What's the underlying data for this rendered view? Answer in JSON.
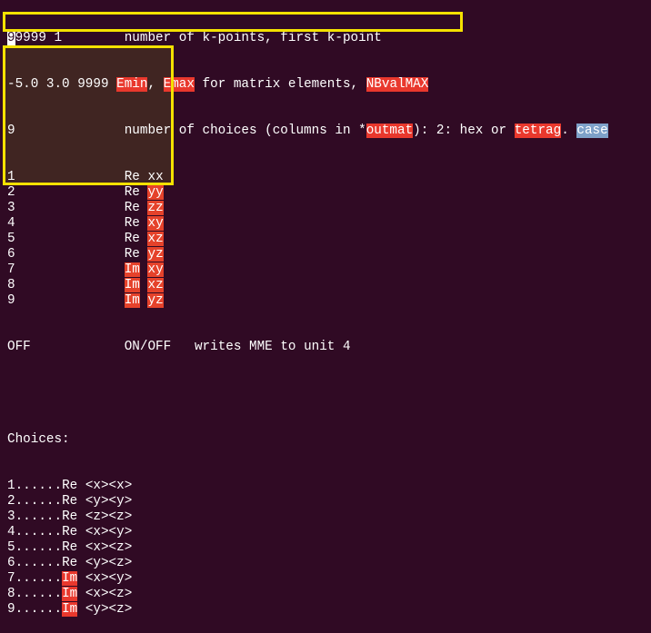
{
  "header_lines": {
    "l1_value_cursor": "9",
    "l1_value": "9999 1",
    "l1_desc": "number of k-points, first k-point",
    "l2_value": "-5.0 3.0 9999 ",
    "l2_emin": "Emin",
    "l2_sep1": ", ",
    "l2_emax": "Emax",
    "l2_mid": " for matrix elements, ",
    "l2_nbval": "NBvalMAX",
    "l3_value": "9",
    "l3_desc_a": "number of choices (columns in *",
    "l3_outmat": "outmat",
    "l3_desc_b": "): 2: hex or ",
    "l3_tetrag": "tetrag",
    "l3_dot": ". ",
    "l3_case": "case"
  },
  "choice_rows": [
    {
      "n": "1",
      "part": "Re",
      "comp": "xx",
      "part_hl": false,
      "comp_hl": false
    },
    {
      "n": "2",
      "part": "Re",
      "comp": "yy",
      "part_hl": false,
      "comp_hl": true
    },
    {
      "n": "3",
      "part": "Re",
      "comp": "zz",
      "part_hl": false,
      "comp_hl": true
    },
    {
      "n": "4",
      "part": "Re",
      "comp": "xy",
      "part_hl": false,
      "comp_hl": true
    },
    {
      "n": "5",
      "part": "Re",
      "comp": "xz",
      "part_hl": false,
      "comp_hl": true
    },
    {
      "n": "6",
      "part": "Re",
      "comp": "yz",
      "part_hl": false,
      "comp_hl": true
    },
    {
      "n": "7",
      "part": "Im",
      "comp": "xy",
      "part_hl": true,
      "comp_hl": true
    },
    {
      "n": "8",
      "part": "Im",
      "comp": "xz",
      "part_hl": true,
      "comp_hl": true
    },
    {
      "n": "9",
      "part": "Im",
      "comp": "yz",
      "part_hl": true,
      "comp_hl": true
    }
  ],
  "mme_line": {
    "value": "OFF",
    "options": "ON/OFF",
    "desc": "writes MME to unit 4"
  },
  "choices_title": "Choices:",
  "choices_list": [
    {
      "prefix": "1......",
      "part": "Re",
      "elem": " <x><x>"
    },
    {
      "prefix": "2......",
      "part": "Re",
      "elem": " <y><y>"
    },
    {
      "prefix": "3......",
      "part": "Re",
      "elem": " <z><z>"
    },
    {
      "prefix": "4......",
      "part": "Re",
      "elem": " <x><y>"
    },
    {
      "prefix": "5......",
      "part": "Re",
      "elem": " <x><z>"
    },
    {
      "prefix": "6......",
      "part": "Re",
      "elem": " <y><z>"
    },
    {
      "prefix": "7......",
      "part": "Im",
      "elem": " <x><y>"
    },
    {
      "prefix": "8......",
      "part": "Im",
      "elem": " <x><z>"
    },
    {
      "prefix": "9......",
      "part": "Im",
      "elem": " <y><z>"
    }
  ],
  "colors": {
    "background": "#300a24",
    "highlight": "#e9382d",
    "selection": "#7ea1c9",
    "box": "#f4e100"
  }
}
